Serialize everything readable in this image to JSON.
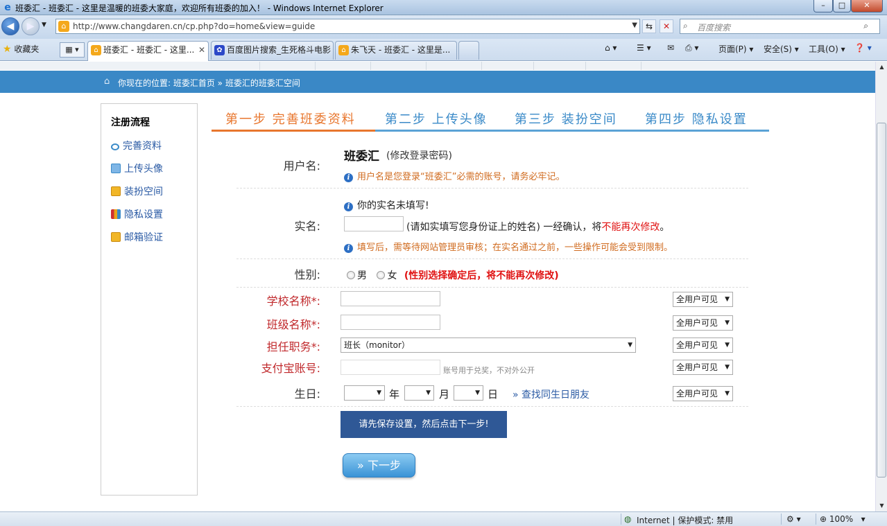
{
  "window": {
    "title": "班委汇 - 班委汇 - 这里是温暖的班委大家庭，欢迎所有班委的加入！ - Windows Internet Explorer",
    "minimize": "–",
    "maximize": "□",
    "close": "✕"
  },
  "address": {
    "url": "http://www.changdaren.cn/cp.php?do=home&view=guide",
    "search_placeholder": "百度搜索"
  },
  "tabs": {
    "favorites_label": "收藏夹",
    "items": [
      {
        "label": "班委汇 - 班委汇 - 这里..."
      },
      {
        "label": "百度图片搜索_生死格斗电影"
      },
      {
        "label": "朱飞天 - 班委汇 - 这里是..."
      }
    ],
    "commands": {
      "page": "页面(P)",
      "safety": "安全(S)",
      "tools": "工具(O)"
    }
  },
  "breadcrumb": "你现在的位置: 班委汇首页 » 班委汇的班委汇空间",
  "sidebar": {
    "heading": "注册流程",
    "items": [
      {
        "label": "完善资料",
        "color": "#3a8ac8"
      },
      {
        "label": "上传头像",
        "color": "#3a8ac8"
      },
      {
        "label": "装扮空间",
        "color": "#e8a21a"
      },
      {
        "label": "隐私设置",
        "color": "#d03030"
      },
      {
        "label": "邮箱验证",
        "color": "#e8a21a"
      }
    ]
  },
  "steps": [
    {
      "label": "第一步 完善班委资料"
    },
    {
      "label": "第二步 上传头像"
    },
    {
      "label": "第三步 装扮空间"
    },
    {
      "label": "第四步 隐私设置"
    }
  ],
  "form": {
    "username": {
      "label": "用户名:",
      "value": "班委汇",
      "change_pw": "(修改登录密码)",
      "hint": "用户名是您登录“班委汇”必需的账号，请务必牢记。"
    },
    "realname": {
      "label": "实名:",
      "notice": "你的实名未填写!",
      "after_input": "(请如实填写您身份证上的姓名)  一经确认，将",
      "warn": "不能再次修改",
      "warn_end": "。",
      "hint": "填写后，需等待网站管理员审核；在实名通过之前，一些操作可能会受到限制。"
    },
    "gender": {
      "label": "性别:",
      "male": "男",
      "female": "女",
      "warn": "(性别选择确定后，将不能再次修改)"
    },
    "school": {
      "label": "学校名称*:",
      "visibility": "全用户可见"
    },
    "class": {
      "label": "班级名称*:",
      "visibility": "全用户可见"
    },
    "position": {
      "label": "担任职务*:",
      "value": "班长（monitor）",
      "visibility": "全用户可见"
    },
    "alipay": {
      "label": "支付宝账号:",
      "hint": "账号用于兑奖，不对外公开",
      "visibility": "全用户可见"
    },
    "birthday": {
      "label": "生日:",
      "year": "年",
      "month": "月",
      "day": "日",
      "find_link": "» 查找同生日朋友",
      "visibility": "全用户可见"
    },
    "save_notice": "请先保存设置，然后点击下一步!",
    "next_button": "下一步"
  },
  "status": {
    "zone": "Internet | 保护模式: 禁用",
    "zoom": "100%"
  }
}
